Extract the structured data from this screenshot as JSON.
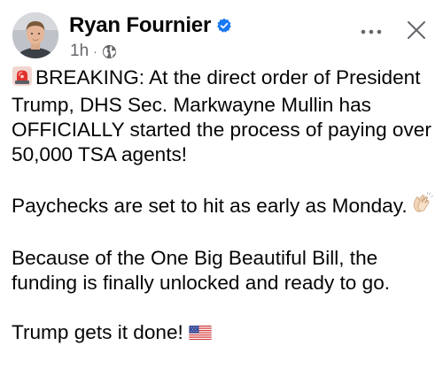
{
  "post": {
    "author_name": "Ryan Fournier",
    "timestamp": "1h",
    "separator": "·",
    "paragraphs": [
      {
        "text": "BREAKING: At the direct order of President Trump, DHS Sec. Markwayne Mullin has OFFICIALLY started the process of paying over 50,000 TSA agents!",
        "leading_icon": "rotating-light-emoji"
      },
      {
        "text": "Paychecks are set to hit as early as Monday.",
        "trailing_icon": "clapping-hands-emoji"
      },
      {
        "text": "Because of the One Big Beautiful Bill, the funding is finally unlocked and ready to go."
      },
      {
        "text": "Trump gets it done!",
        "trailing_icon": "us-flag-emoji"
      }
    ]
  },
  "icons": {
    "verified": "verified-badge-icon",
    "audience": "globe-icon",
    "more": "more-options-icon",
    "close": "close-icon"
  },
  "colors": {
    "text": "#050505",
    "secondary_text": "#65676b",
    "verified_blue": "#1877f2",
    "background": "#ffffff"
  }
}
